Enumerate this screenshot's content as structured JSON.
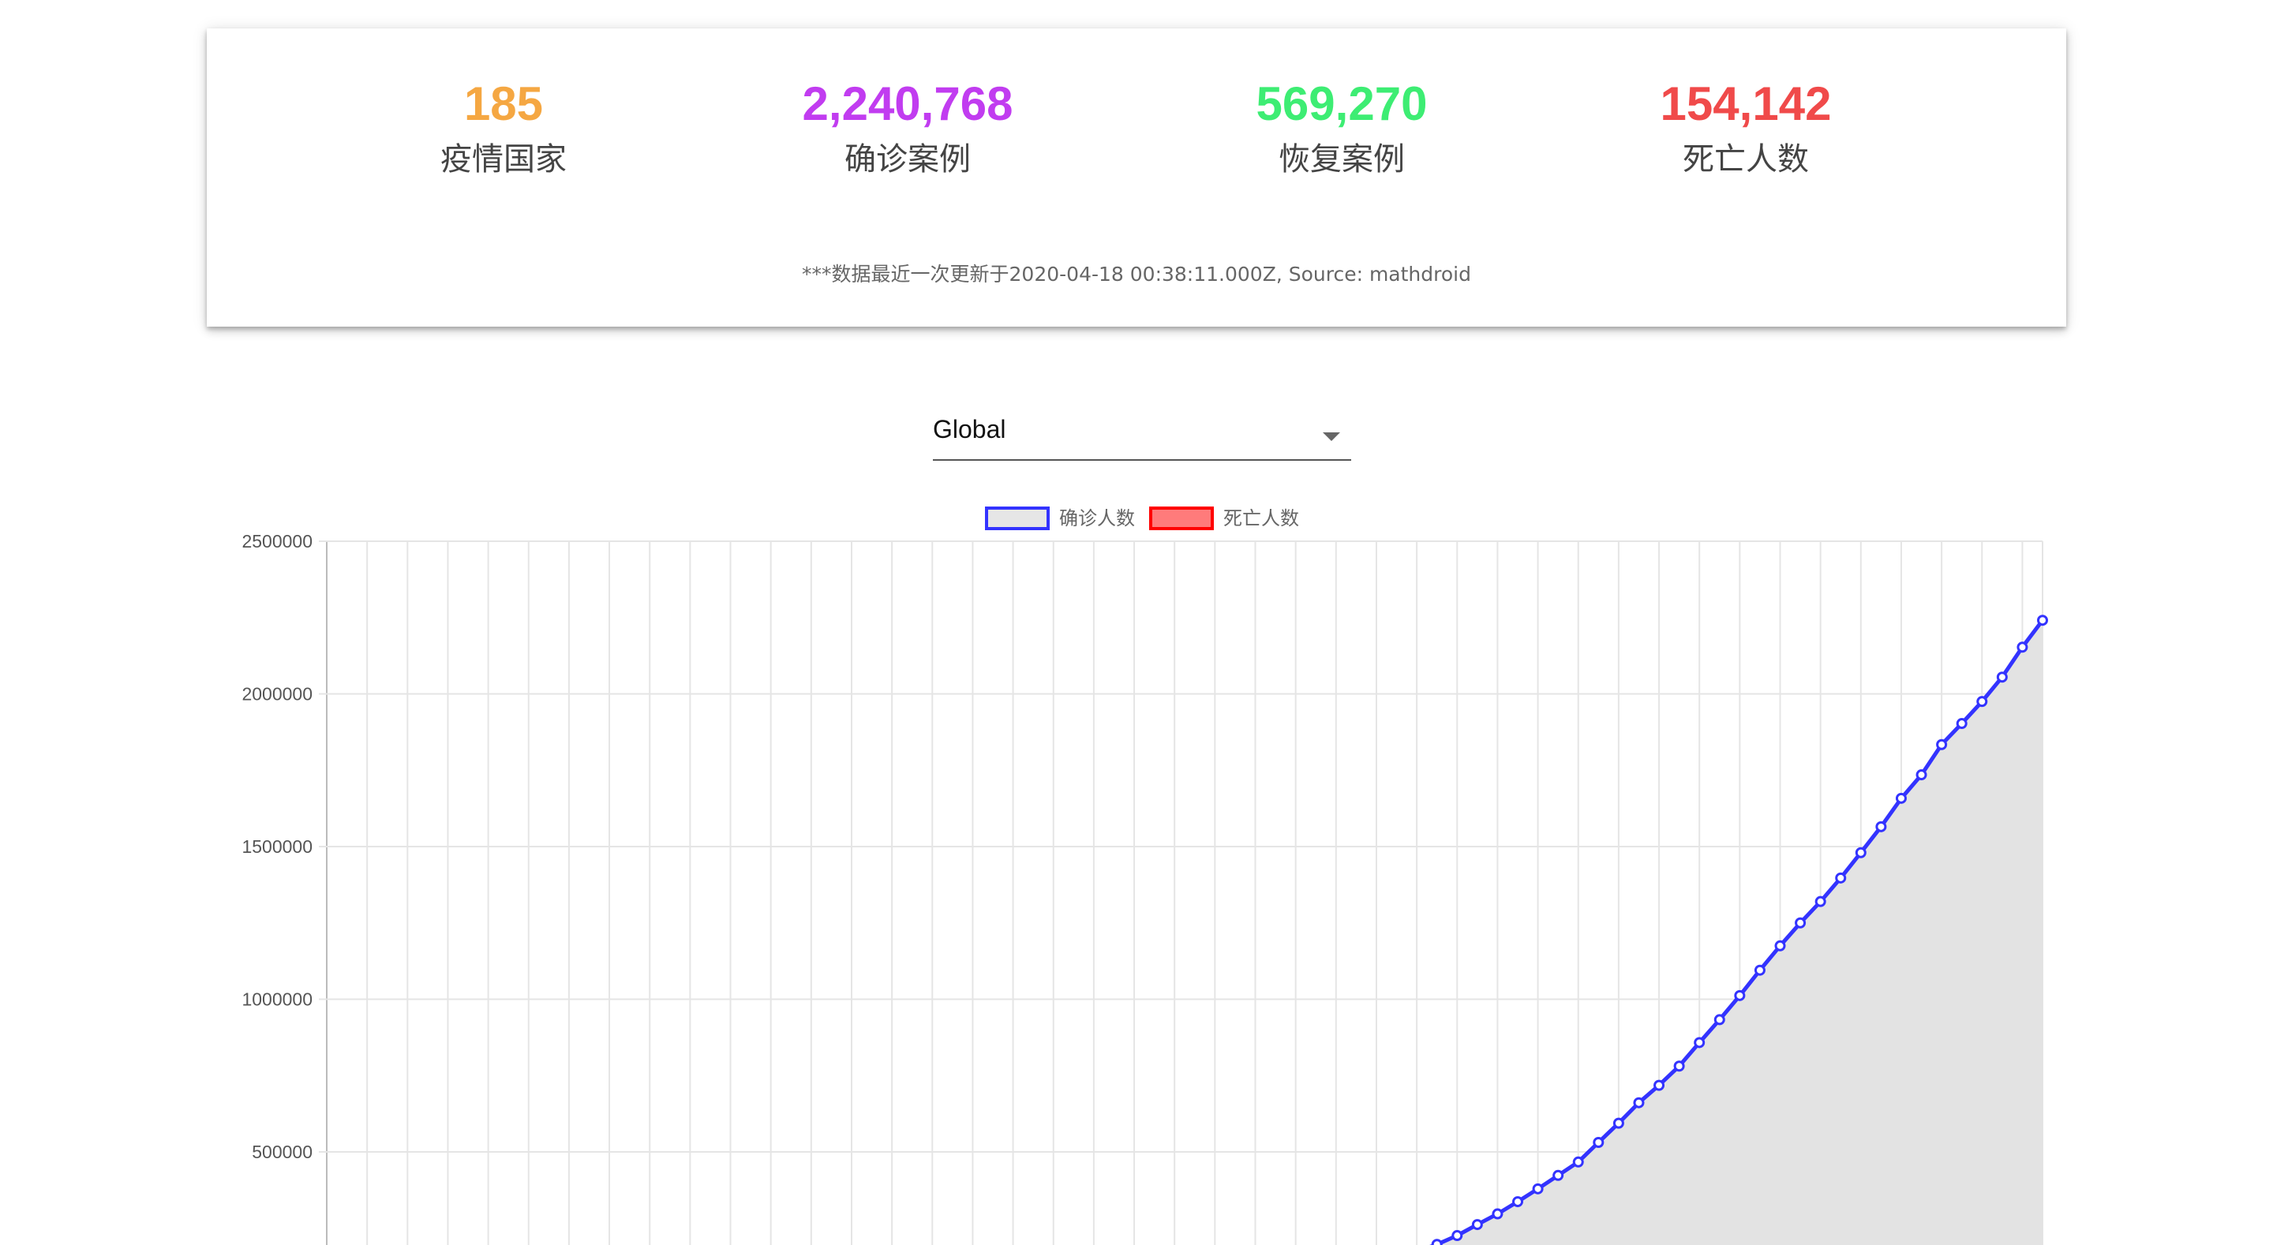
{
  "stats": [
    {
      "value": "185",
      "label": "疫情国家",
      "color": "#f5a742"
    },
    {
      "value": "2,240,768",
      "label": "确诊案例",
      "color": "#c13cf0"
    },
    {
      "value": "569,270",
      "label": "恢复案例",
      "color": "#3ded73"
    },
    {
      "value": "154,142",
      "label": "死亡人数",
      "color": "#f04a4a"
    }
  ],
  "footnote": "***数据最近一次更新于2020-04-18 00:38:11.000Z, Source: mathdroid",
  "country_select": {
    "value": "Global"
  },
  "chart_data": {
    "type": "line",
    "legend": [
      {
        "label": "确诊人数",
        "border": "#3333ff",
        "fill": "#e6e6e6"
      },
      {
        "label": "死亡人数",
        "border": "#ff0000",
        "fill": "#ff7b7b"
      }
    ],
    "legend_position": "top",
    "y_ticks": [
      "2500000",
      "2000000",
      "1500000",
      "1000000",
      "500000"
    ],
    "ylim": [
      0,
      2500000
    ],
    "x_count": 86,
    "grid": true,
    "series": [
      {
        "name": "确诊人数",
        "color": "#3333ff",
        "area_fill": "#e3e3e3",
        "start_index": 53,
        "values": [
          160000,
          174000,
          197000,
          226000,
          262000,
          297000,
          337000,
          379000,
          423000,
          467000,
          531000,
          594000,
          661000,
          718000,
          781000,
          858000,
          933000,
          1012000,
          1095000,
          1175000,
          1250000,
          1320000,
          1397000,
          1480000,
          1565000,
          1658000,
          1735000,
          1834000,
          1903000,
          1975000,
          2055000,
          2153000,
          2241000
        ]
      }
    ]
  }
}
